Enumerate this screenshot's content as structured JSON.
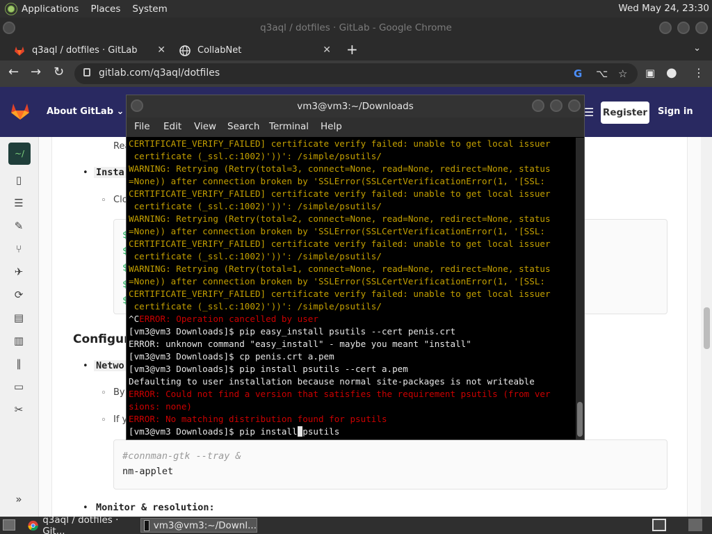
{
  "top_panel": {
    "menus": [
      "Applications",
      "Places",
      "System"
    ],
    "clock": "Wed May 24, 23:30"
  },
  "chrome": {
    "window_title": "q3aql / dotfiles · GitLab - Google Chrome",
    "tabs": [
      {
        "label": "q3aql / dotfiles · GitLab",
        "close": "✕"
      },
      {
        "label": "CollabNet",
        "close": "✕"
      }
    ],
    "new_tab": "+",
    "tab_menu": "⌄",
    "url": "gitlab.com/q3aql/dotfiles"
  },
  "gitlab": {
    "about": "About GitLab ⌄",
    "register": "Register",
    "signin": "Sign in",
    "project_badge": "~/",
    "content": {
      "rea": "Rea",
      "insta": "Insta",
      "clo": "Clo",
      "configura": "Configura",
      "netwo": "Netwo",
      "by": "By d",
      "if": "If yo",
      "code_comment": "#connman-gtk --tray &",
      "code_line": "nm-applet",
      "monitor": "Monitor & resolution:",
      "dollar": "$"
    }
  },
  "terminal": {
    "title": "vm3@vm3:~/Downloads",
    "menu": [
      "File",
      "Edit",
      "View",
      "Search",
      "Terminal",
      "Help"
    ],
    "lines": [
      {
        "c": "warn",
        "t": "CERTIFICATE_VERIFY_FAILED] certificate verify failed: unable to get local issuer"
      },
      {
        "c": "warn",
        "t": " certificate (_ssl.c:1002)'))': /simple/psutils/"
      },
      {
        "c": "warn",
        "t": "WARNING: Retrying (Retry(total=3, connect=None, read=None, redirect=None, status"
      },
      {
        "c": "warn",
        "t": "=None)) after connection broken by 'SSLError(SSLCertVerificationError(1, '[SSL:"
      },
      {
        "c": "warn",
        "t": "CERTIFICATE_VERIFY_FAILED] certificate verify failed: unable to get local issuer"
      },
      {
        "c": "warn",
        "t": " certificate (_ssl.c:1002)'))': /simple/psutils/"
      },
      {
        "c": "warn",
        "t": "WARNING: Retrying (Retry(total=2, connect=None, read=None, redirect=None, status"
      },
      {
        "c": "warn",
        "t": "=None)) after connection broken by 'SSLError(SSLCertVerificationError(1, '[SSL:"
      },
      {
        "c": "warn",
        "t": "CERTIFICATE_VERIFY_FAILED] certificate verify failed: unable to get local issuer"
      },
      {
        "c": "warn",
        "t": " certificate (_ssl.c:1002)'))': /simple/psutils/"
      },
      {
        "c": "warn",
        "t": "WARNING: Retrying (Retry(total=1, connect=None, read=None, redirect=None, status"
      },
      {
        "c": "warn",
        "t": "=None)) after connection broken by 'SSLError(SSLCertVerificationError(1, '[SSL:"
      },
      {
        "c": "warn",
        "t": "CERTIFICATE_VERIFY_FAILED] certificate verify failed: unable to get local issuer"
      },
      {
        "c": "warn",
        "t": " certificate (_ssl.c:1002)'))': /simple/psutils/"
      },
      {
        "c": "mixed",
        "pre": "^C",
        "t": "ERROR: Operation cancelled by user"
      },
      {
        "c": "plain",
        "t": "[vm3@vm3 Downloads]$ pip easy_install psutils --cert penis.crt"
      },
      {
        "c": "plain",
        "t": "ERROR: unknown command \"easy_install\" - maybe you meant \"install\""
      },
      {
        "c": "plain",
        "t": "[vm3@vm3 Downloads]$ cp penis.crt a.pem"
      },
      {
        "c": "plain",
        "t": "[vm3@vm3 Downloads]$ pip install psutils --cert a.pem"
      },
      {
        "c": "plain",
        "t": "Defaulting to user installation because normal site-packages is not writeable"
      },
      {
        "c": "err",
        "t": "ERROR: Could not find a version that satisfies the requirement psutils (from ver"
      },
      {
        "c": "err",
        "t": "sions: none)"
      },
      {
        "c": "err",
        "t": "ERROR: No matching distribution found for psutils"
      },
      {
        "c": "prompt",
        "t": "[vm3@vm3 Downloads]$ pip install",
        "after": "psutils"
      }
    ]
  },
  "taskbar": {
    "items": [
      "q3aql / dotfiles · Git...",
      "vm3@vm3:~/Downl..."
    ]
  }
}
